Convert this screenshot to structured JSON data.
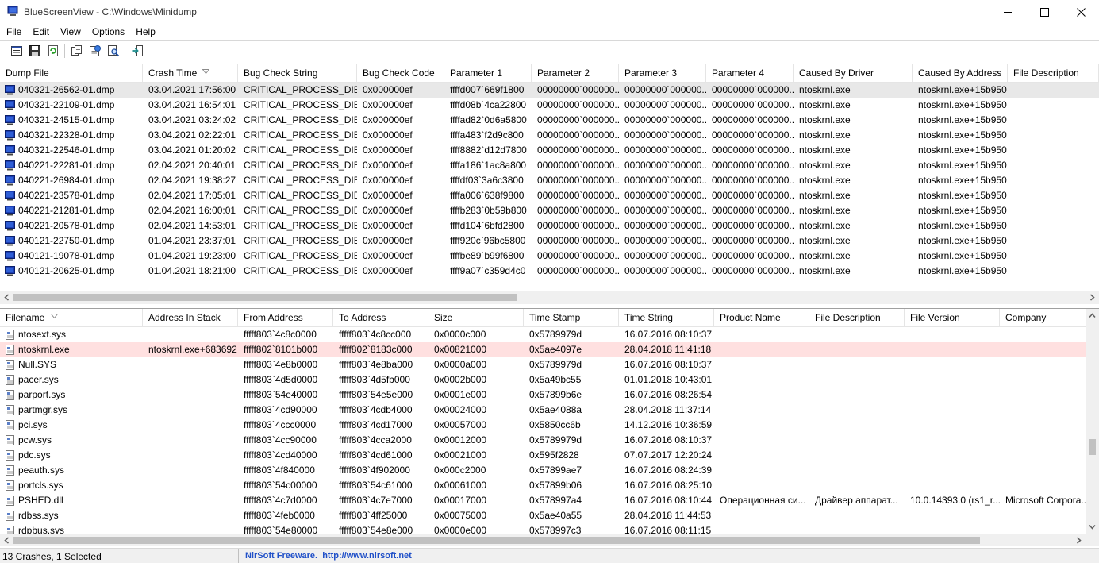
{
  "window": {
    "title": "BlueScreenView  -  C:\\Windows\\Minidump"
  },
  "menu": {
    "items": [
      "File",
      "Edit",
      "View",
      "Options",
      "Help"
    ]
  },
  "toolbar": {
    "buttons": [
      "properties-icon",
      "save-icon",
      "refresh-icon",
      "copy-icon",
      "html-report-icon",
      "find-icon",
      "exit-icon"
    ]
  },
  "crashes": {
    "columns": [
      "Dump File",
      "Crash Time",
      "Bug Check String",
      "Bug Check Code",
      "Parameter 1",
      "Parameter 2",
      "Parameter 3",
      "Parameter 4",
      "Caused By Driver",
      "Caused By Address",
      "File Description"
    ],
    "sorted_column": "Crash Time",
    "selected_index": 0,
    "rows": [
      [
        "040321-26562-01.dmp",
        "03.04.2021 17:56:00",
        "CRITICAL_PROCESS_DIED",
        "0x000000ef",
        "ffffd007`669f1800",
        "00000000`000000...",
        "00000000`000000...",
        "00000000`000000...",
        "ntoskrnl.exe",
        "ntoskrnl.exe+15b950",
        ""
      ],
      [
        "040321-22109-01.dmp",
        "03.04.2021 16:54:01",
        "CRITICAL_PROCESS_DIED",
        "0x000000ef",
        "ffffd08b`4ca22800",
        "00000000`000000...",
        "00000000`000000...",
        "00000000`000000...",
        "ntoskrnl.exe",
        "ntoskrnl.exe+15b950",
        ""
      ],
      [
        "040321-24515-01.dmp",
        "03.04.2021 03:24:02",
        "CRITICAL_PROCESS_DIED",
        "0x000000ef",
        "ffffad82`0d6a5800",
        "00000000`000000...",
        "00000000`000000...",
        "00000000`000000...",
        "ntoskrnl.exe",
        "ntoskrnl.exe+15b950",
        ""
      ],
      [
        "040321-22328-01.dmp",
        "03.04.2021 02:22:01",
        "CRITICAL_PROCESS_DIED",
        "0x000000ef",
        "ffffa483`f2d9c800",
        "00000000`000000...",
        "00000000`000000...",
        "00000000`000000...",
        "ntoskrnl.exe",
        "ntoskrnl.exe+15b950",
        ""
      ],
      [
        "040321-22546-01.dmp",
        "03.04.2021 01:20:02",
        "CRITICAL_PROCESS_DIED",
        "0x000000ef",
        "ffff8882`d12d7800",
        "00000000`000000...",
        "00000000`000000...",
        "00000000`000000...",
        "ntoskrnl.exe",
        "ntoskrnl.exe+15b950",
        ""
      ],
      [
        "040221-22281-01.dmp",
        "02.04.2021 20:40:01",
        "CRITICAL_PROCESS_DIED",
        "0x000000ef",
        "ffffa186`1ac8a800",
        "00000000`000000...",
        "00000000`000000...",
        "00000000`000000...",
        "ntoskrnl.exe",
        "ntoskrnl.exe+15b950",
        ""
      ],
      [
        "040221-26984-01.dmp",
        "02.04.2021 19:38:27",
        "CRITICAL_PROCESS_DIED",
        "0x000000ef",
        "ffffdf03`3a6c3800",
        "00000000`000000...",
        "00000000`000000...",
        "00000000`000000...",
        "ntoskrnl.exe",
        "ntoskrnl.exe+15b950",
        ""
      ],
      [
        "040221-23578-01.dmp",
        "02.04.2021 17:05:01",
        "CRITICAL_PROCESS_DIED",
        "0x000000ef",
        "ffffa006`638f9800",
        "00000000`000000...",
        "00000000`000000...",
        "00000000`000000...",
        "ntoskrnl.exe",
        "ntoskrnl.exe+15b950",
        ""
      ],
      [
        "040221-21281-01.dmp",
        "02.04.2021 16:00:01",
        "CRITICAL_PROCESS_DIED",
        "0x000000ef",
        "ffffb283`0b59b800",
        "00000000`000000...",
        "00000000`000000...",
        "00000000`000000...",
        "ntoskrnl.exe",
        "ntoskrnl.exe+15b950",
        ""
      ],
      [
        "040221-20578-01.dmp",
        "02.04.2021 14:53:01",
        "CRITICAL_PROCESS_DIED",
        "0x000000ef",
        "ffffd104`6bfd2800",
        "00000000`000000...",
        "00000000`000000...",
        "00000000`000000...",
        "ntoskrnl.exe",
        "ntoskrnl.exe+15b950",
        ""
      ],
      [
        "040121-22750-01.dmp",
        "01.04.2021 23:37:01",
        "CRITICAL_PROCESS_DIED",
        "0x000000ef",
        "ffff920c`96bc5800",
        "00000000`000000...",
        "00000000`000000...",
        "00000000`000000...",
        "ntoskrnl.exe",
        "ntoskrnl.exe+15b950",
        ""
      ],
      [
        "040121-19078-01.dmp",
        "01.04.2021 19:23:00",
        "CRITICAL_PROCESS_DIED",
        "0x000000ef",
        "ffffbe89`b99f6800",
        "00000000`000000...",
        "00000000`000000...",
        "00000000`000000...",
        "ntoskrnl.exe",
        "ntoskrnl.exe+15b950",
        ""
      ],
      [
        "040121-20625-01.dmp",
        "01.04.2021 18:21:00",
        "CRITICAL_PROCESS_DIED",
        "0x000000ef",
        "ffff9a07`c359d4c0",
        "00000000`000000...",
        "00000000`000000...",
        "00000000`000000...",
        "ntoskrnl.exe",
        "ntoskrnl.exe+15b950",
        ""
      ]
    ]
  },
  "drivers": {
    "columns": [
      "Filename",
      "Address In Stack",
      "From Address",
      "To Address",
      "Size",
      "Time Stamp",
      "Time String",
      "Product Name",
      "File Description",
      "File Version",
      "Company"
    ],
    "sorted_column": "Filename",
    "highlighted_index": 1,
    "rows": [
      [
        "ntosext.sys",
        "",
        "fffff803`4c8c0000",
        "fffff803`4c8cc000",
        "0x0000c000",
        "0x5789979d",
        "16.07.2016 08:10:37",
        "",
        "",
        "",
        ""
      ],
      [
        "ntoskrnl.exe",
        "ntoskrnl.exe+683692",
        "fffff802`8101b000",
        "fffff802`8183c000",
        "0x00821000",
        "0x5ae4097e",
        "28.04.2018 11:41:18",
        "",
        "",
        "",
        ""
      ],
      [
        "Null.SYS",
        "",
        "fffff803`4e8b0000",
        "fffff803`4e8ba000",
        "0x0000a000",
        "0x5789979d",
        "16.07.2016 08:10:37",
        "",
        "",
        "",
        ""
      ],
      [
        "pacer.sys",
        "",
        "fffff803`4d5d0000",
        "fffff803`4d5fb000",
        "0x0002b000",
        "0x5a49bc55",
        "01.01.2018 10:43:01",
        "",
        "",
        "",
        ""
      ],
      [
        "parport.sys",
        "",
        "fffff803`54e40000",
        "fffff803`54e5e000",
        "0x0001e000",
        "0x57899b6e",
        "16.07.2016 08:26:54",
        "",
        "",
        "",
        ""
      ],
      [
        "partmgr.sys",
        "",
        "fffff803`4cd90000",
        "fffff803`4cdb4000",
        "0x00024000",
        "0x5ae4088a",
        "28.04.2018 11:37:14",
        "",
        "",
        "",
        ""
      ],
      [
        "pci.sys",
        "",
        "fffff803`4ccc0000",
        "fffff803`4cd17000",
        "0x00057000",
        "0x5850cc6b",
        "14.12.2016 10:36:59",
        "",
        "",
        "",
        ""
      ],
      [
        "pcw.sys",
        "",
        "fffff803`4cc90000",
        "fffff803`4cca2000",
        "0x00012000",
        "0x5789979d",
        "16.07.2016 08:10:37",
        "",
        "",
        "",
        ""
      ],
      [
        "pdc.sys",
        "",
        "fffff803`4cd40000",
        "fffff803`4cd61000",
        "0x00021000",
        "0x595f2828",
        "07.07.2017 12:20:24",
        "",
        "",
        "",
        ""
      ],
      [
        "peauth.sys",
        "",
        "fffff803`4f840000",
        "fffff803`4f902000",
        "0x000c2000",
        "0x57899ae7",
        "16.07.2016 08:24:39",
        "",
        "",
        "",
        ""
      ],
      [
        "portcls.sys",
        "",
        "fffff803`54c00000",
        "fffff803`54c61000",
        "0x00061000",
        "0x57899b06",
        "16.07.2016 08:25:10",
        "",
        "",
        "",
        ""
      ],
      [
        "PSHED.dll",
        "",
        "fffff803`4c7d0000",
        "fffff803`4c7e7000",
        "0x00017000",
        "0x578997a4",
        "16.07.2016 08:10:44",
        "Операционная си...",
        "Драйвер аппарат...",
        "10.0.14393.0 (rs1_r...",
        "Microsoft Corpora..."
      ],
      [
        "rdbss.sys",
        "",
        "fffff803`4feb0000",
        "fffff803`4ff25000",
        "0x00075000",
        "0x5ae40a55",
        "28.04.2018 11:44:53",
        "",
        "",
        "",
        ""
      ],
      [
        "rdpbus.sys",
        "",
        "fffff803`54e80000",
        "fffff803`54e8e000",
        "0x0000e000",
        "0x578997c3",
        "16.07.2016 08:11:15",
        "",
        "",
        "",
        ""
      ]
    ]
  },
  "status": {
    "left": "13 Crashes, 1 Selected",
    "right": "NirSoft Freeware.  http://www.nirsoft.net"
  }
}
